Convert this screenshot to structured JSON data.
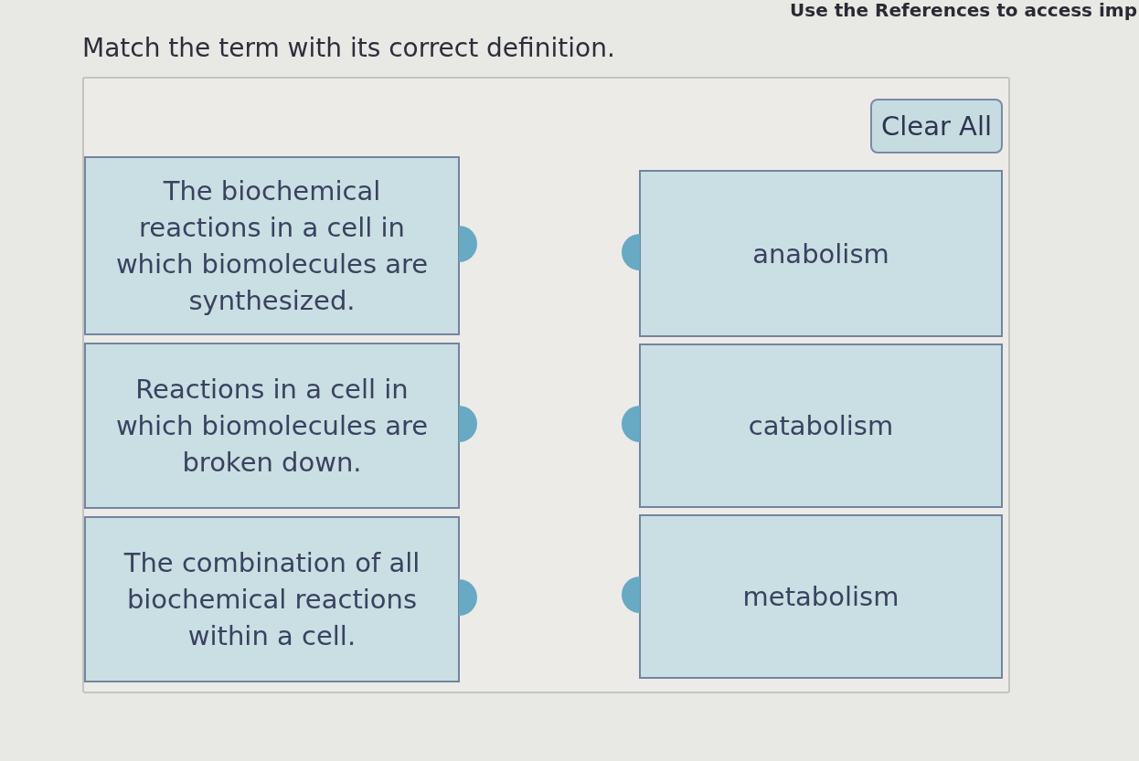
{
  "header_note": "Use the References to access imp",
  "prompt": "Match the term with its correct definition.",
  "clear_button": "Clear All",
  "definitions": [
    {
      "text": "The biochemical reactions in a cell in which biomolecules are synthesized."
    },
    {
      "text": "Reactions in a cell in which biomolecules are broken down."
    },
    {
      "text": "The combination of all biochemical reactions within a cell."
    }
  ],
  "terms": [
    {
      "text": "anabolism"
    },
    {
      "text": "catabolism"
    },
    {
      "text": "metabolism"
    }
  ]
}
